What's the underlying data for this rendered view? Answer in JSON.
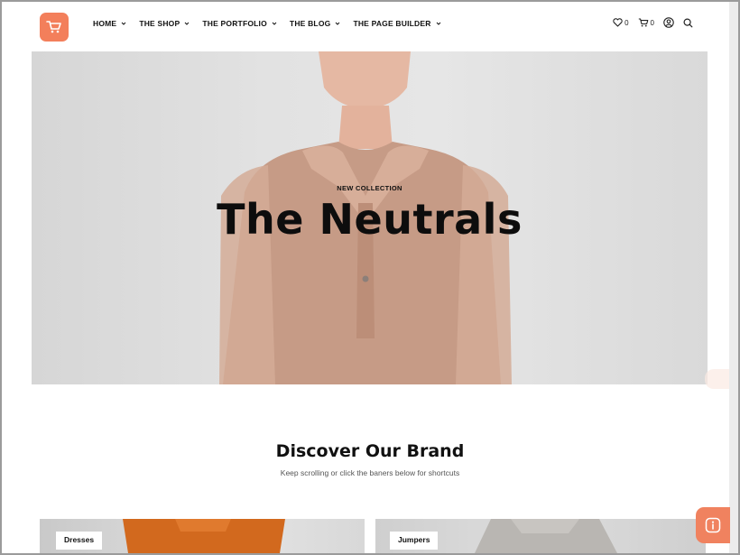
{
  "nav": {
    "items": [
      {
        "label": "HOME"
      },
      {
        "label": "THE SHOP"
      },
      {
        "label": "THE PORTFOLIO"
      },
      {
        "label": "THE BLOG"
      },
      {
        "label": "THE PAGE BUILDER"
      }
    ]
  },
  "utility": {
    "wishlist_count": "0",
    "cart_count": "0"
  },
  "hero": {
    "eyebrow": "NEW COLLECTION",
    "title": "The Neutrals"
  },
  "section": {
    "title": "Discover Our Brand",
    "subtitle": "Keep scrolling or click the baners below for shortcuts"
  },
  "cards": [
    {
      "label": "Dresses"
    },
    {
      "label": "Jumpers"
    }
  ],
  "colors": {
    "accent": "#f37f5b",
    "text": "#111111"
  },
  "icons": {
    "logo": "shopping-cart-icon",
    "wishlist": "heart-icon",
    "cart": "cart-icon",
    "account": "user-icon",
    "search": "search-icon",
    "help": "info-icon"
  }
}
